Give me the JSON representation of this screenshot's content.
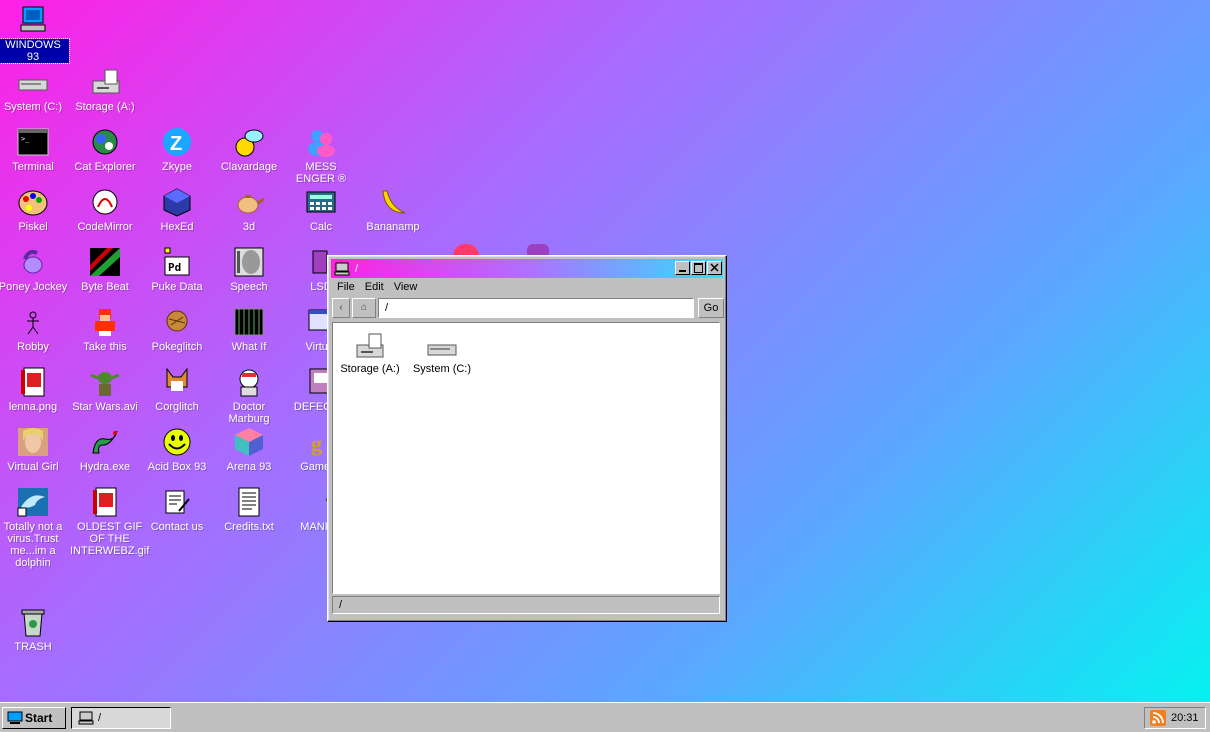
{
  "desktop": {
    "icons": [
      {
        "label": "WINDOWS 93",
        "icon": "computer-icon"
      },
      {
        "label": "System (C:)",
        "icon": "drive-icon"
      },
      {
        "label": "Storage (A:)",
        "icon": "floppy-drive-icon"
      },
      {
        "label": "Terminal",
        "icon": "terminal-icon"
      },
      {
        "label": "Cat Explorer",
        "icon": "cat-globe-icon"
      },
      {
        "label": "Zkype",
        "icon": "zkype-icon"
      },
      {
        "label": "Clavardage",
        "icon": "chat-smiley-icon"
      },
      {
        "label": "MESS ENGER ®",
        "icon": "messenger-icon"
      },
      {
        "label": "Piskel",
        "icon": "palette-icon"
      },
      {
        "label": "CodeMirror",
        "icon": "codemirror-icon"
      },
      {
        "label": "HexEd",
        "icon": "cube-icon"
      },
      {
        "label": "3d",
        "icon": "teapot-icon"
      },
      {
        "label": "Calc",
        "icon": "calculator-icon"
      },
      {
        "label": "Bananamp",
        "icon": "banana-icon"
      },
      {
        "label": "Poney Jockey",
        "icon": "pony-icon"
      },
      {
        "label": "Byte Beat",
        "icon": "bytebeat-icon"
      },
      {
        "label": "Puke Data",
        "icon": "puredata-icon"
      },
      {
        "label": "Speech",
        "icon": "face-icon"
      },
      {
        "label": "LSD",
        "icon": "lsd-icon"
      },
      {
        "label": "Robby",
        "icon": "stick-figure-icon"
      },
      {
        "label": "Take this",
        "icon": "take-this-icon"
      },
      {
        "label": "Pokeglitch",
        "icon": "pokeglitch-icon"
      },
      {
        "label": "What If",
        "icon": "what-if-icon"
      },
      {
        "label": "Virtual",
        "icon": "virtual-icon"
      },
      {
        "label": "lenna.png",
        "icon": "image-file-icon"
      },
      {
        "label": "Star Wars.avi",
        "icon": "yoda-icon"
      },
      {
        "label": "Corglitch",
        "icon": "corgi-icon"
      },
      {
        "label": "Doctor Marburg",
        "icon": "doctor-icon"
      },
      {
        "label": "DEFECT E",
        "icon": "defect-icon"
      },
      {
        "label": "Virtual Girl",
        "icon": "virtual-girl-icon"
      },
      {
        "label": "Hydra.exe",
        "icon": "hydra-icon"
      },
      {
        "label": "Acid Box 93",
        "icon": "acid-smiley-icon"
      },
      {
        "label": "Arena 93",
        "icon": "arena-cube-icon"
      },
      {
        "label": "Game O",
        "icon": "game-icon"
      },
      {
        "label": "Totally not a virus.Trust me...im a dolphin",
        "icon": "dolphin-icon"
      },
      {
        "label": "OLDEST GIF OF THE INTERWEBZ.gif",
        "icon": "gif-file-icon"
      },
      {
        "label": "Contact us",
        "icon": "contact-icon"
      },
      {
        "label": "Credits.txt",
        "icon": "text-file-icon"
      },
      {
        "label": "MANIFE",
        "icon": "question-icon"
      },
      {
        "label": "TRASH",
        "icon": "trash-icon"
      }
    ]
  },
  "window": {
    "title": "/",
    "menu": [
      "File",
      "Edit",
      "View"
    ],
    "back_glyph": "‹",
    "home_glyph": "⌂",
    "address": "/",
    "go_label": "Go",
    "items": [
      {
        "label": "Storage (A:)",
        "icon": "floppy-drive-icon"
      },
      {
        "label": "System (C:)",
        "icon": "drive-icon"
      }
    ],
    "status": "/"
  },
  "taskbar": {
    "start_label": "Start",
    "task_label": "/",
    "clock": "20:31"
  }
}
